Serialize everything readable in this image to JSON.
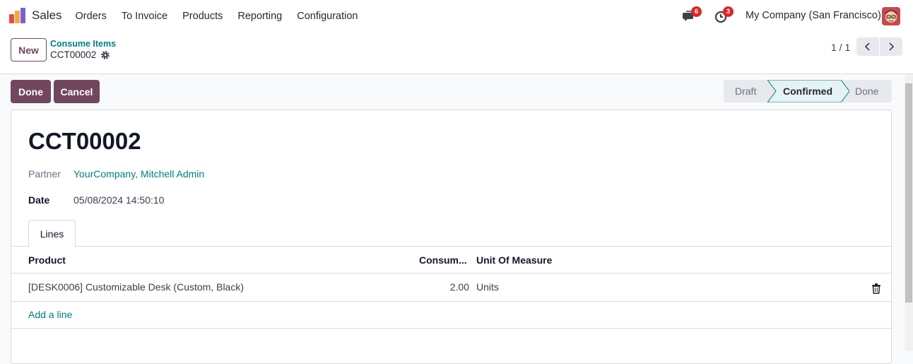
{
  "navbar": {
    "app_name": "Sales",
    "menu": [
      "Orders",
      "To Invoice",
      "Products",
      "Reporting",
      "Configuration"
    ],
    "messages_count": "6",
    "activities_count": "3",
    "company": "My Company (San Francisco)"
  },
  "control_panel": {
    "new_label": "New",
    "breadcrumb_parent": "Consume Items",
    "breadcrumb_current": "CCT00002",
    "pager": "1 / 1"
  },
  "actions": {
    "done_label": "Done",
    "cancel_label": "Cancel"
  },
  "statusbar": {
    "steps": [
      "Draft",
      "Confirmed",
      "Done"
    ],
    "active": "Confirmed"
  },
  "record": {
    "name": "CCT00002",
    "partner_label": "Partner",
    "partner_value": "YourCompany, Mitchell Admin",
    "date_label": "Date",
    "date_value": "05/08/2024 14:50:10"
  },
  "tabs": [
    "Lines"
  ],
  "lines_table": {
    "headers": [
      "Product",
      "Consum...",
      "Unit Of Measure"
    ],
    "rows": [
      {
        "product": "[DESK0006] Customizable Desk (Custom, Black)",
        "consumed": "2.00",
        "uom": "Units"
      }
    ],
    "add_line": "Add a line"
  },
  "colors": {
    "brand": "#71465e",
    "link": "#017e84",
    "badge": "#dc2626"
  }
}
